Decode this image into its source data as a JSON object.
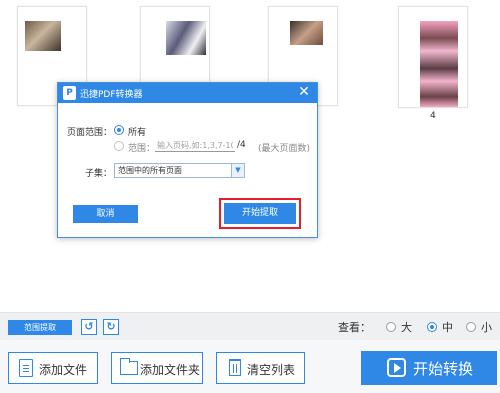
{
  "thumbnails": [
    {
      "page": "",
      "picture": "page-1-preview"
    },
    {
      "page": "",
      "picture": "page-2-preview"
    },
    {
      "page": "",
      "picture": "page-3-preview"
    },
    {
      "page": "4",
      "picture": "page-4-preview"
    }
  ],
  "dialog": {
    "title": "迅捷PDF转换器",
    "app_icon_glyph": "P",
    "close_glyph": "✕",
    "page_range_label": "页面范围：",
    "all_label": "所有",
    "range_label": "范围：",
    "range_placeholder": "输入页码,如:1,3,7-10",
    "total_pages": "/4",
    "max_pages_note": "(最大页面数)",
    "subset_label": "子集：",
    "subset_value": "范围中的所有页面",
    "subset_arrow": "▼",
    "cancel_label": "取消",
    "start_extract_label": "开始提取"
  },
  "toolbar": {
    "range_extract_label": "范围提取",
    "rotate_left_glyph": "↺",
    "rotate_right_glyph": "↻",
    "view_label": "查看：",
    "view_options": [
      "大",
      "中",
      "小"
    ],
    "view_selected": "中"
  },
  "bottom": {
    "add_file_label": "添加文件",
    "add_folder_label": "添加文件夹",
    "clear_list_label": "清空列表",
    "start_convert_label": "开始转换"
  },
  "colors": {
    "accent": "#2f88e6",
    "highlight": "#e0202a"
  }
}
